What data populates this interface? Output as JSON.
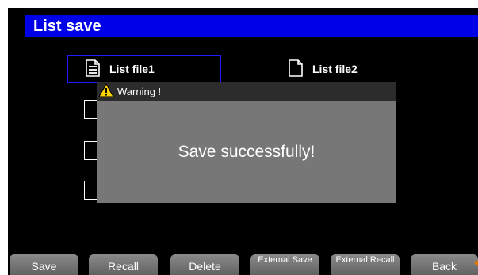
{
  "title": "List save",
  "files": [
    {
      "label": "List file1",
      "icon": "document-filled-icon",
      "selected": true
    },
    {
      "label": "List file2",
      "icon": "document-empty-icon",
      "selected": false
    }
  ],
  "dialog": {
    "header": "Warning !",
    "icon": "warning-icon",
    "message": "Save successfully!"
  },
  "softkeys": [
    "Save",
    "Recall",
    "Delete",
    "External Save",
    "External Recall",
    "Back"
  ],
  "colors": {
    "title_bar": "#0000e8",
    "selection_border": "#1c1cff",
    "dialog_body": "#777777",
    "dialog_header": "#2c2c2c",
    "warning_icon": "#ffd400"
  }
}
